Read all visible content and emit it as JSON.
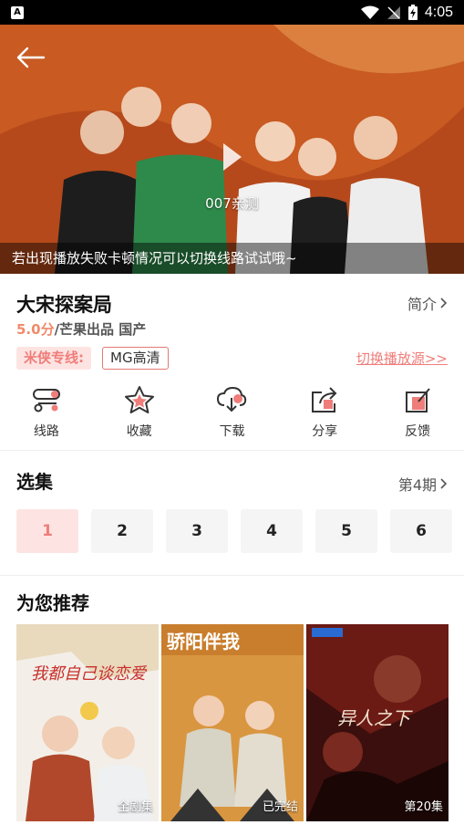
{
  "status_bar": {
    "time": "4:05",
    "left_badge": "A"
  },
  "player": {
    "center_label": "007亲测",
    "tip": "若出现播放失败卡顿情况可以切换线路试试哦~"
  },
  "show": {
    "title": "大宋探案局",
    "intro_label": "简介",
    "score": "5.0分",
    "meta_rest": "/芒果出品 国产",
    "line_label": "米侠专线:",
    "quality": "MG高清",
    "switch_source": "切换播放源>>"
  },
  "actions": [
    {
      "label": "线路",
      "icon": "route-icon"
    },
    {
      "label": "收藏",
      "icon": "star-icon"
    },
    {
      "label": "下载",
      "icon": "download-cloud-icon"
    },
    {
      "label": "分享",
      "icon": "share-icon"
    },
    {
      "label": "反馈",
      "icon": "feedback-icon"
    }
  ],
  "episodes": {
    "title": "选集",
    "more_label": "第4期",
    "items": [
      "1",
      "2",
      "3",
      "4",
      "5",
      "6"
    ],
    "active_index": 0
  },
  "recommend": {
    "title": "为您推荐",
    "items": [
      {
        "badge": "全剧集",
        "poster_text": "我都自己谈恋爱"
      },
      {
        "badge": "已完结",
        "poster_text": "骄阳伴我"
      },
      {
        "badge": "第20集",
        "poster_text": "异人之下"
      }
    ]
  },
  "colors": {
    "accent": "#ef7d7a",
    "accent_bg": "#fde4e2",
    "score": "#ef8b6c"
  }
}
